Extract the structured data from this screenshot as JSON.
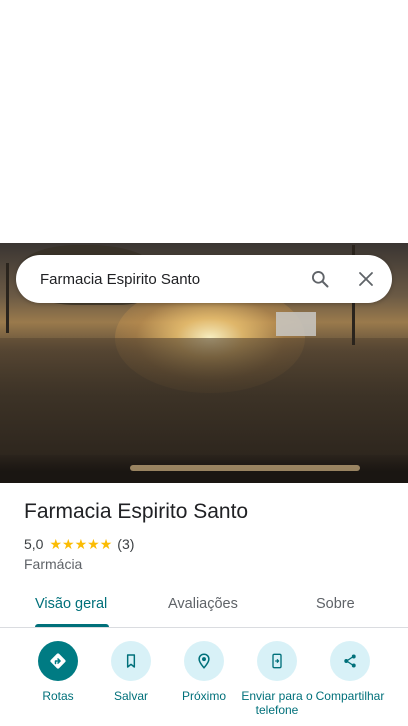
{
  "search": {
    "query": "Farmacia Espirito Santo"
  },
  "place": {
    "name": "Farmacia Espirito Santo",
    "rating": "5,0",
    "stars": 5,
    "review_count": "(3)",
    "category": "Farmácia"
  },
  "tabs": [
    {
      "label": "Visão geral",
      "active": true
    },
    {
      "label": "Avaliações",
      "active": false
    },
    {
      "label": "Sobre",
      "active": false
    }
  ],
  "actions": [
    {
      "label": "Rotas",
      "icon": "directions-icon"
    },
    {
      "label": "Salvar",
      "icon": "bookmark-icon"
    },
    {
      "label": "Próximo",
      "icon": "nearby-icon"
    },
    {
      "label": "Enviar para o telefone",
      "icon": "send-to-phone-icon"
    },
    {
      "label": "Compartilhar",
      "icon": "share-icon"
    }
  ],
  "colors": {
    "accent": "#00707a",
    "primary_button": "#007b83",
    "action_bg": "#d8f1f7",
    "star": "#fbbc04"
  }
}
